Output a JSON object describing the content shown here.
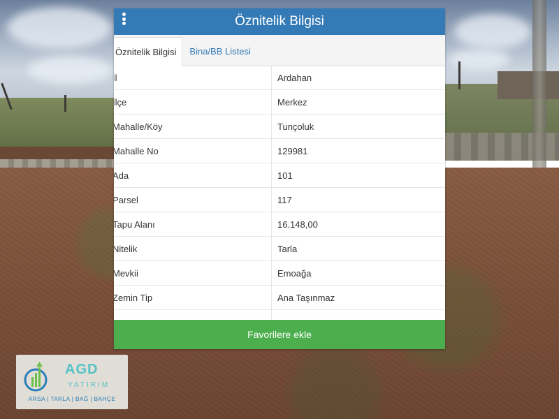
{
  "panel": {
    "title": "Öznitelik Bilgisi",
    "menu_icon": "kebab-menu-icon",
    "header_color": "#337ab7"
  },
  "tabs": [
    {
      "label": "Öznitelik Bilgisi",
      "active": true
    },
    {
      "label": "Bina/BB Listesi",
      "active": false
    }
  ],
  "attributes": [
    {
      "key": "İl",
      "value": "Ardahan"
    },
    {
      "key": "İlçe",
      "value": "Merkez"
    },
    {
      "key": "Mahalle/Köy",
      "value": "Tunçoluk"
    },
    {
      "key": "Mahalle No",
      "value": "129981"
    },
    {
      "key": "Ada",
      "value": "101"
    },
    {
      "key": "Parsel",
      "value": "117"
    },
    {
      "key": "Tapu Alanı",
      "value": "16.148,00"
    },
    {
      "key": "Nitelik",
      "value": "Tarla"
    },
    {
      "key": "Mevkii",
      "value": "Emoağa"
    },
    {
      "key": "Zemin Tip",
      "value": "Ana Taşınmaz"
    },
    {
      "key": "",
      "value": ""
    }
  ],
  "actions": {
    "favorite_label": "Favorilere ekle",
    "favorite_color": "#4cae4c"
  },
  "logo": {
    "name": "AGD",
    "subtitle": "YATIRIM",
    "tagline": "ARSA | TARLA | BAĞ | BAHÇE"
  }
}
